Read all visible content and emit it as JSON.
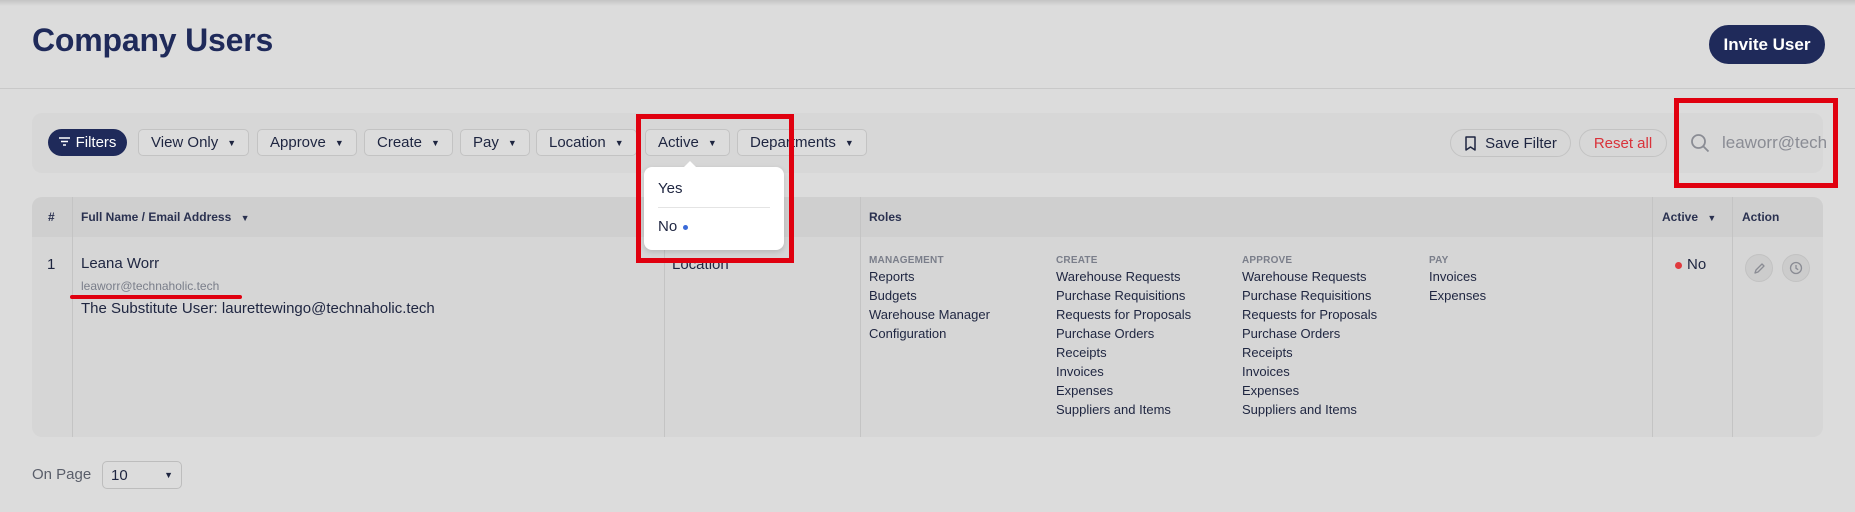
{
  "header": {
    "title": "Company Users",
    "invite_label": "Invite User"
  },
  "filters": {
    "filters_label": "Filters",
    "chips": [
      "View Only",
      "Approve",
      "Create",
      "Pay",
      "Location",
      "Active",
      "Departments"
    ],
    "save_filter_label": "Save Filter",
    "reset_label": "Reset all"
  },
  "search": {
    "value": "leaworr@technaholic.tech"
  },
  "active_dropdown": {
    "options": [
      "Yes",
      "No"
    ],
    "selected": "No"
  },
  "table": {
    "columns": {
      "num": "#",
      "name": "Full Name / Email Address",
      "roles": "Roles",
      "active": "Active",
      "action": "Action"
    },
    "rows": [
      {
        "num": "1",
        "name": "Leana Worr",
        "email": "leaworr@technaholic.tech",
        "substitute": "The Substitute User: laurettewingo@technaholic.tech",
        "location": "Location",
        "active": "No",
        "roles": {
          "management": {
            "title": "MANAGEMENT",
            "items": [
              "Reports",
              "Budgets",
              "Warehouse Manager",
              "Configuration"
            ]
          },
          "create": {
            "title": "CREATE",
            "items": [
              "Warehouse Requests",
              "Purchase Requisitions",
              "Requests for Proposals",
              "Purchase Orders",
              "Receipts",
              "Invoices",
              "Expenses",
              "Suppliers and Items"
            ]
          },
          "approve": {
            "title": "APPROVE",
            "items": [
              "Warehouse Requests",
              "Purchase Requisitions",
              "Requests for Proposals",
              "Purchase Orders",
              "Receipts",
              "Invoices",
              "Expenses",
              "Suppliers and Items"
            ]
          },
          "pay": {
            "title": "PAY",
            "items": [
              "Invoices",
              "Expenses"
            ]
          }
        }
      }
    ]
  },
  "pagination": {
    "on_page_label": "On Page",
    "value": "10"
  },
  "icons": [
    "filter-icon",
    "chevron-down-icon",
    "bookmark-icon",
    "search-icon",
    "edit-icon",
    "clock-icon"
  ],
  "colors": {
    "primary": "#1f2a5a",
    "danger": "#d9323a",
    "highlight": "#e0000f",
    "status_inactive": "#e03a3e"
  }
}
